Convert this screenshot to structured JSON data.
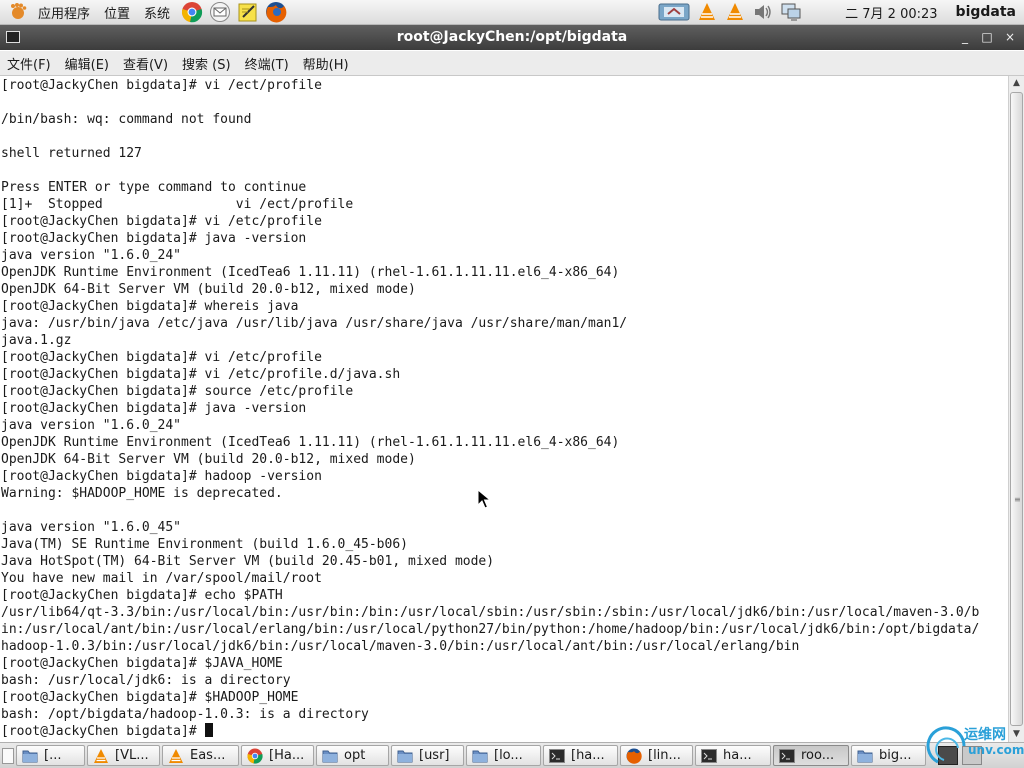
{
  "top_panel": {
    "menus": [
      "应用程序",
      "位置",
      "系统"
    ],
    "launchers": [
      "chrome-icon",
      "mail-icon",
      "notes-icon",
      "firefox-icon"
    ],
    "tray_icons": [
      "network-icon",
      "vlc-icon",
      "vlc-icon",
      "volume-icon",
      "display-icon"
    ],
    "clock": "二 7月  2 00:23",
    "user": "bigdata"
  },
  "window": {
    "title": "root@JackyChen:/opt/bigdata",
    "controls": [
      "_",
      "□",
      "×"
    ]
  },
  "menubar": [
    "文件(F)",
    "编辑(E)",
    "查看(V)",
    "搜索 (S)",
    "终端(T)",
    "帮助(H)"
  ],
  "terminal": {
    "lines": [
      "[root@JackyChen bigdata]# vi /ect/profile",
      "",
      "/bin/bash: wq: command not found",
      "",
      "shell returned 127",
      "",
      "Press ENTER or type command to continue",
      "[1]+  Stopped                 vi /ect/profile",
      "[root@JackyChen bigdata]# vi /etc/profile",
      "[root@JackyChen bigdata]# java -version",
      "java version \"1.6.0_24\"",
      "OpenJDK Runtime Environment (IcedTea6 1.11.11) (rhel-1.61.1.11.11.el6_4-x86_64)",
      "OpenJDK 64-Bit Server VM (build 20.0-b12, mixed mode)",
      "[root@JackyChen bigdata]# whereis java",
      "java: /usr/bin/java /etc/java /usr/lib/java /usr/share/java /usr/share/man/man1/",
      "java.1.gz",
      "[root@JackyChen bigdata]# vi /etc/profile",
      "[root@JackyChen bigdata]# vi /etc/profile.d/java.sh",
      "[root@JackyChen bigdata]# source /etc/profile",
      "[root@JackyChen bigdata]# java -version",
      "java version \"1.6.0_24\"",
      "OpenJDK Runtime Environment (IcedTea6 1.11.11) (rhel-1.61.1.11.11.el6_4-x86_64)",
      "OpenJDK 64-Bit Server VM (build 20.0-b12, mixed mode)",
      "[root@JackyChen bigdata]# hadoop -version",
      "Warning: $HADOOP_HOME is deprecated.",
      "",
      "java version \"1.6.0_45\"",
      "Java(TM) SE Runtime Environment (build 1.6.0_45-b06)",
      "Java HotSpot(TM) 64-Bit Server VM (build 20.45-b01, mixed mode)",
      "You have new mail in /var/spool/mail/root",
      "[root@JackyChen bigdata]# echo $PATH",
      "/usr/lib64/qt-3.3/bin:/usr/local/bin:/usr/bin:/bin:/usr/local/sbin:/usr/sbin:/sbin:/usr/local/jdk6/bin:/usr/local/maven-3.0/b",
      "in:/usr/local/ant/bin:/usr/local/erlang/bin:/usr/local/python27/bin/python:/home/hadoop/bin:/usr/local/jdk6/bin:/opt/bigdata/",
      "hadoop-1.0.3/bin:/usr/local/jdk6/bin:/usr/local/maven-3.0/bin:/usr/local/ant/bin:/usr/local/erlang/bin",
      "[root@JackyChen bigdata]# $JAVA_HOME",
      "bash: /usr/local/jdk6: is a directory",
      "[root@JackyChen bigdata]# $HADOOP_HOME",
      "bash: /opt/bigdata/hadoop-1.0.3: is a directory"
    ],
    "prompt": "[root@JackyChen bigdata]# "
  },
  "taskbar": [
    {
      "label": "[...",
      "icon": "folder-icon"
    },
    {
      "label": "[VL...",
      "icon": "vlc-icon"
    },
    {
      "label": "Eas...",
      "icon": "vlc-icon"
    },
    {
      "label": "[Ha...",
      "icon": "chrome-icon"
    },
    {
      "label": "opt",
      "icon": "folder-icon"
    },
    {
      "label": "[usr]",
      "icon": "folder-icon"
    },
    {
      "label": "[lo...",
      "icon": "folder-icon"
    },
    {
      "label": "[ha...",
      "icon": "terminal-icon"
    },
    {
      "label": "[lin...",
      "icon": "firefox-icon"
    },
    {
      "label": "ha...",
      "icon": "terminal-icon"
    },
    {
      "label": "roo...",
      "icon": "terminal-icon",
      "active": true
    },
    {
      "label": "big...",
      "icon": "folder-icon"
    }
  ],
  "watermark": {
    "text": "运维网",
    "sub": "unv.com"
  },
  "colors": {
    "terminal_bg": "#ffffff",
    "terminal_fg": "#1a1a1a",
    "titlebar": "#4a4a4a",
    "panel": "#e2e2e2",
    "watermark": "#2aa0d8"
  }
}
